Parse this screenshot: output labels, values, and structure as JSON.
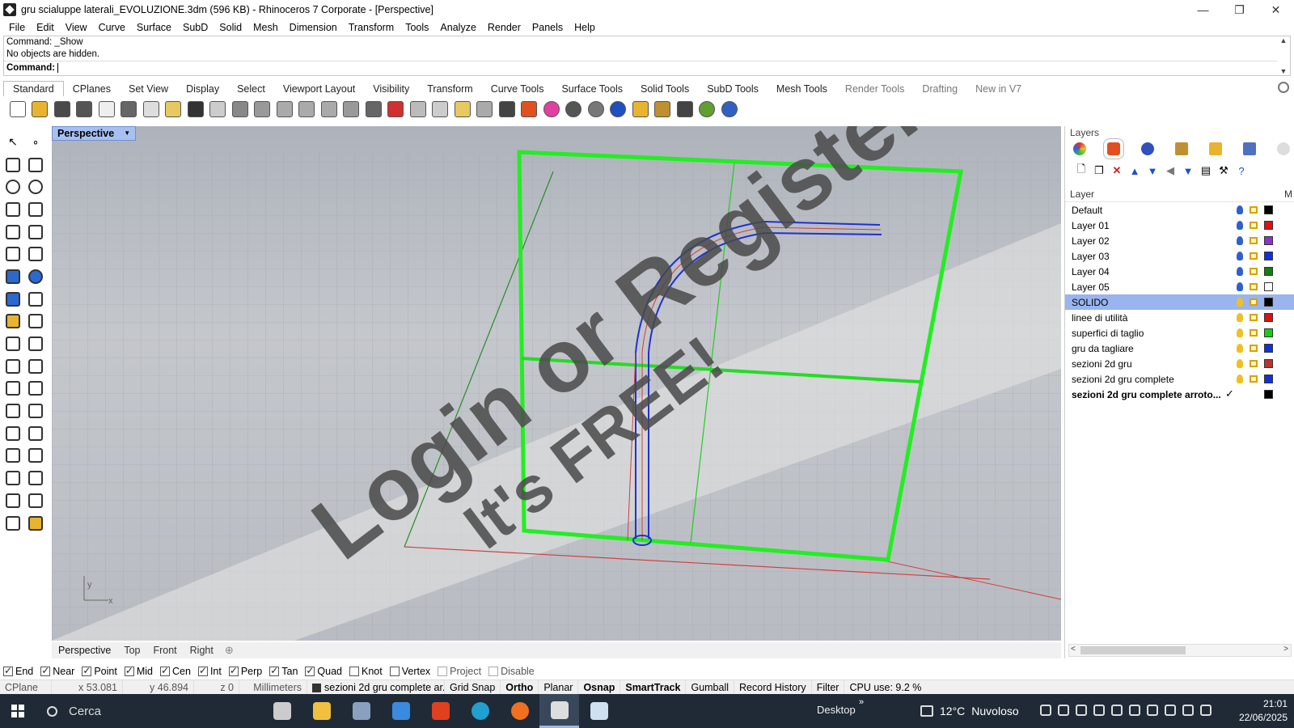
{
  "window": {
    "title": "gru scialuppe laterali_EVOLUZIONE.3dm (596 KB) - Rhinoceros 7 Corporate - [Perspective]",
    "minimize": "—",
    "maximize": "❐",
    "close": "✕"
  },
  "menu": [
    "File",
    "Edit",
    "View",
    "Curve",
    "Surface",
    "SubD",
    "Solid",
    "Mesh",
    "Dimension",
    "Transform",
    "Tools",
    "Analyze",
    "Render",
    "Panels",
    "Help"
  ],
  "command": {
    "history": [
      "Command: _Show",
      "No objects are hidden."
    ],
    "prompt": "Command:"
  },
  "toolbar_tabs": [
    {
      "label": "Standard",
      "active": true
    },
    {
      "label": "CPlanes"
    },
    {
      "label": "Set View"
    },
    {
      "label": "Display"
    },
    {
      "label": "Select"
    },
    {
      "label": "Viewport Layout"
    },
    {
      "label": "Visibility"
    },
    {
      "label": "Transform"
    },
    {
      "label": "Curve Tools"
    },
    {
      "label": "Surface Tools"
    },
    {
      "label": "Solid Tools"
    },
    {
      "label": "SubD Tools"
    },
    {
      "label": "Mesh Tools"
    },
    {
      "label": "Render Tools",
      "dim": true
    },
    {
      "label": "Drafting",
      "dim": true
    },
    {
      "label": "New in V7",
      "dim": true
    }
  ],
  "toolbar_icons": [
    {
      "name": "new-file-icon",
      "color": "#ffffff"
    },
    {
      "name": "open-folder-icon",
      "color": "#e8b430"
    },
    {
      "name": "save-icon",
      "color": "#4a4a4a"
    },
    {
      "name": "print-icon",
      "color": "#555555"
    },
    {
      "name": "import-icon",
      "color": "#eeeeee"
    },
    {
      "name": "cut-icon",
      "color": "#666666"
    },
    {
      "name": "copy-icon",
      "color": "#dddddd"
    },
    {
      "name": "paste-icon",
      "color": "#e8c860"
    },
    {
      "name": "undo-icon",
      "color": "#333333"
    },
    {
      "name": "pan-hand-icon",
      "color": "#cccccc"
    },
    {
      "name": "move-arrows-icon",
      "color": "#888888"
    },
    {
      "name": "zoom-icon",
      "color": "#999999"
    },
    {
      "name": "zoom-window-icon",
      "color": "#aaaaaa"
    },
    {
      "name": "zoom-extents-icon",
      "color": "#aaaaaa"
    },
    {
      "name": "zoom-selected-icon",
      "color": "#aaaaaa"
    },
    {
      "name": "rotate-view-icon",
      "color": "#999999"
    },
    {
      "name": "four-viewports-icon",
      "color": "#666666"
    },
    {
      "name": "car-icon",
      "color": "#d03030"
    },
    {
      "name": "plane-icon",
      "color": "#bbbbbb"
    },
    {
      "name": "cplane-icon",
      "color": "#cccccc"
    },
    {
      "name": "point-icon",
      "color": "#e8c860"
    },
    {
      "name": "light-bulb-icon",
      "color": "#aaaaaa"
    },
    {
      "name": "lock-icon",
      "color": "#444444"
    },
    {
      "name": "layer-icon",
      "color": "#e05020"
    },
    {
      "name": "color-wheel-icon",
      "color": "#e040a0"
    },
    {
      "name": "shaded-sphere-icon",
      "color": "#555555"
    },
    {
      "name": "rendered-sphere-icon",
      "color": "#777777"
    },
    {
      "name": "render-icon",
      "color": "#2050c0"
    },
    {
      "name": "lamp-icon",
      "color": "#e8b430"
    },
    {
      "name": "gear-icon",
      "color": "#c09030"
    },
    {
      "name": "dimension-icon",
      "color": "#444444"
    },
    {
      "name": "globe-icon",
      "color": "#60a030"
    },
    {
      "name": "help-icon",
      "color": "#3060c0"
    }
  ],
  "left_tools": [
    [
      "select-arrow-icon",
      "point-icon"
    ],
    [
      "polyline-icon",
      "curve-icon"
    ],
    [
      "circle-icon",
      "ellipse-icon"
    ],
    [
      "polygon-icon",
      "rectangle-icon"
    ],
    [
      "arc-icon",
      "fillet-icon"
    ],
    [
      "surface-icon",
      "sweep-icon"
    ],
    [
      "box-icon",
      "sphere-icon"
    ],
    [
      "cylinder-icon",
      "mesh-icon"
    ],
    [
      "explode-icon",
      "trim-icon"
    ],
    [
      "extend-icon",
      "split-icon"
    ],
    [
      "boolean-icon",
      "group-icon"
    ],
    [
      "offset-icon",
      "blend-icon"
    ],
    [
      "text-icon",
      "scale-icon"
    ],
    [
      "array-icon",
      "align-icon"
    ],
    [
      "block-icon",
      "dim-icon"
    ],
    [
      "grid-array-icon",
      "snap-icon"
    ],
    [
      "analyze-icon",
      "check-icon"
    ],
    [
      "solid-icon",
      "paint-icon"
    ]
  ],
  "viewport": {
    "label": "Perspective",
    "axis_y": "y",
    "axis_x": "x",
    "axis_z": "z",
    "watermark_line1": "Login or Register",
    "watermark_line2": "It's FREE!",
    "tabs": [
      "Perspective",
      "Top",
      "Front",
      "Right"
    ],
    "add_tab": "⊕"
  },
  "layers_panel": {
    "title": "Layers",
    "column_layer": "Layer",
    "column_m": "M",
    "layers": [
      {
        "name": "Default",
        "color": "#000000",
        "bulb": "#3060d0"
      },
      {
        "name": "Layer 01",
        "color": "#e01010",
        "bulb": "#3060d0"
      },
      {
        "name": "Layer 02",
        "color": "#9030d0",
        "bulb": "#3060d0"
      },
      {
        "name": "Layer 03",
        "color": "#1030e0",
        "bulb": "#3060d0"
      },
      {
        "name": "Layer 04",
        "color": "#108010",
        "bulb": "#3060d0"
      },
      {
        "name": "Layer 05",
        "color": "#ffffff",
        "bulb": "#3060d0"
      },
      {
        "name": "SOLIDO",
        "color": "#000000",
        "bulb": "#f0c020",
        "selected": true
      },
      {
        "name": "linee di utilità",
        "color": "#e01010",
        "bulb": "#f0c020"
      },
      {
        "name": "superfici di taglio",
        "color": "#10d010",
        "bulb": "#f0c020"
      },
      {
        "name": "gru da tagliare",
        "color": "#1030e0",
        "bulb": "#f0c020"
      },
      {
        "name": "sezioni 2d gru",
        "color": "#c03030",
        "bulb": "#f0c020"
      },
      {
        "name": "sezioni 2d gru complete",
        "color": "#1030e0",
        "bulb": "#f0c020"
      },
      {
        "name": "sezioni 2d gru complete arroto...",
        "color": "#000000",
        "current": true,
        "check": "✓"
      }
    ],
    "scroll_left": "<",
    "scroll_right": ">"
  },
  "osnap": [
    {
      "label": "End",
      "on": true
    },
    {
      "label": "Near",
      "on": true
    },
    {
      "label": "Point",
      "on": true
    },
    {
      "label": "Mid",
      "on": true
    },
    {
      "label": "Cen",
      "on": true
    },
    {
      "label": "Int",
      "on": true
    },
    {
      "label": "Perp",
      "on": true
    },
    {
      "label": "Tan",
      "on": true
    },
    {
      "label": "Quad",
      "on": true
    },
    {
      "label": "Knot",
      "on": false
    },
    {
      "label": "Vertex",
      "on": false
    },
    {
      "label": "Project",
      "on": false,
      "disabled": true
    },
    {
      "label": "Disable",
      "on": false,
      "disabled": true
    }
  ],
  "status": {
    "cplane": "CPlane",
    "x": "x 53.081",
    "y": "y 46.894",
    "z": "z 0",
    "units": "Millimeters",
    "layer": "sezioni 2d gru complete ar...",
    "grid_snap": "Grid Snap",
    "ortho": "Ortho",
    "planar": "Planar",
    "osnap": "Osnap",
    "smarttrack": "SmartTrack",
    "gumball": "Gumball",
    "record_history": "Record History",
    "filter": "Filter",
    "cpu": "CPU use: 9.2 %"
  },
  "taskbar": {
    "search": "Cerca",
    "desktop": "Desktop",
    "chevron": "»",
    "weather_temp": "12°C",
    "weather_desc": "Nuvoloso",
    "time": "21:01",
    "date": "22/06/2025",
    "apps": [
      {
        "name": "task-view-icon",
        "color": "#cccccc"
      },
      {
        "name": "file-explorer-icon",
        "color": "#f0c040"
      },
      {
        "name": "control-panel-icon",
        "color": "#8aa0c0"
      },
      {
        "name": "store-icon",
        "color": "#3a8ae0"
      },
      {
        "name": "office-icon",
        "color": "#e04020"
      },
      {
        "name": "edge-icon",
        "color": "#20a0d0"
      },
      {
        "name": "firefox-icon",
        "color": "#f07020"
      },
      {
        "name": "rhino-icon",
        "color": "#dddddd",
        "active": true
      },
      {
        "name": "notepad-icon",
        "color": "#cfe0f0"
      }
    ]
  }
}
